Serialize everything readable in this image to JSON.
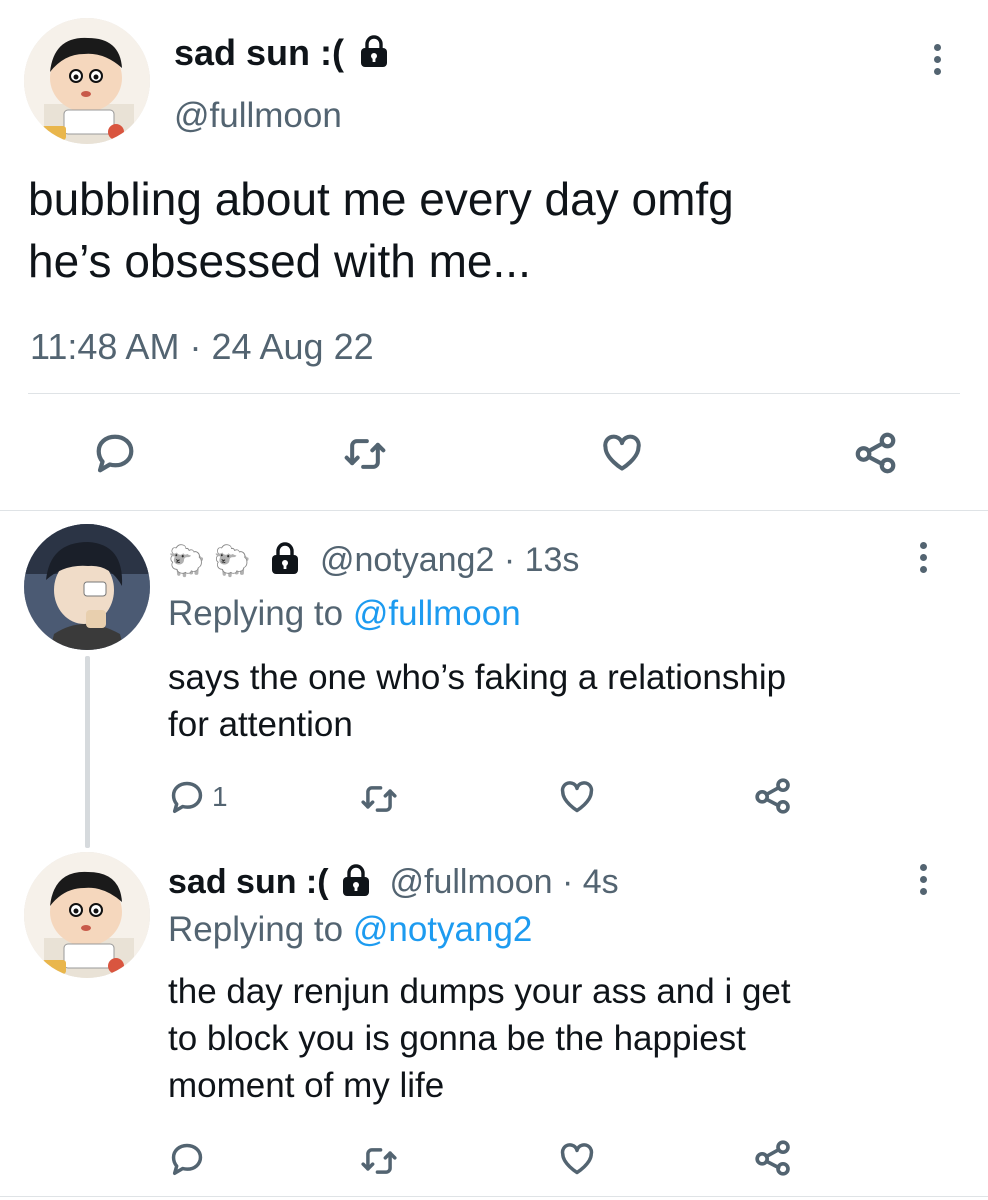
{
  "main_tweet": {
    "display_name": "sad sun :(",
    "handle": "@fullmoon",
    "text_line1": "bubbling about me every day omfg",
    "text_line2": "he’s obsessed with me...",
    "time": "11:48 AM",
    "separator": "·",
    "date": "24 Aug 22"
  },
  "replies": [
    {
      "display_name": "🐑 🐑",
      "handle": "@notyang2",
      "separator": "·",
      "time": "13s",
      "replying_prefix": "Replying to",
      "replying_to": "@fullmoon",
      "text_line1": "says the one who’s faking a relationship",
      "text_line2": "for attention",
      "reply_count": "1"
    },
    {
      "display_name": "sad sun :(",
      "handle": "@fullmoon",
      "separator": "·",
      "time": "4s",
      "replying_prefix": "Replying to",
      "replying_to": "@notyang2",
      "text_line1": "the day renjun dumps your ass and i get",
      "text_line2": "to block you is gonna be the happiest",
      "text_line3": "moment of my life"
    }
  ],
  "icons": {
    "reply": "reply-icon",
    "retweet": "retweet-icon",
    "like": "like-icon",
    "share": "share-icon",
    "lock": "lock-icon",
    "more": "more-options-icon"
  },
  "colors": {
    "text": "#0f1419",
    "secondary": "#536471",
    "link": "#1d9bf0",
    "divider": "#dfe3e6"
  }
}
